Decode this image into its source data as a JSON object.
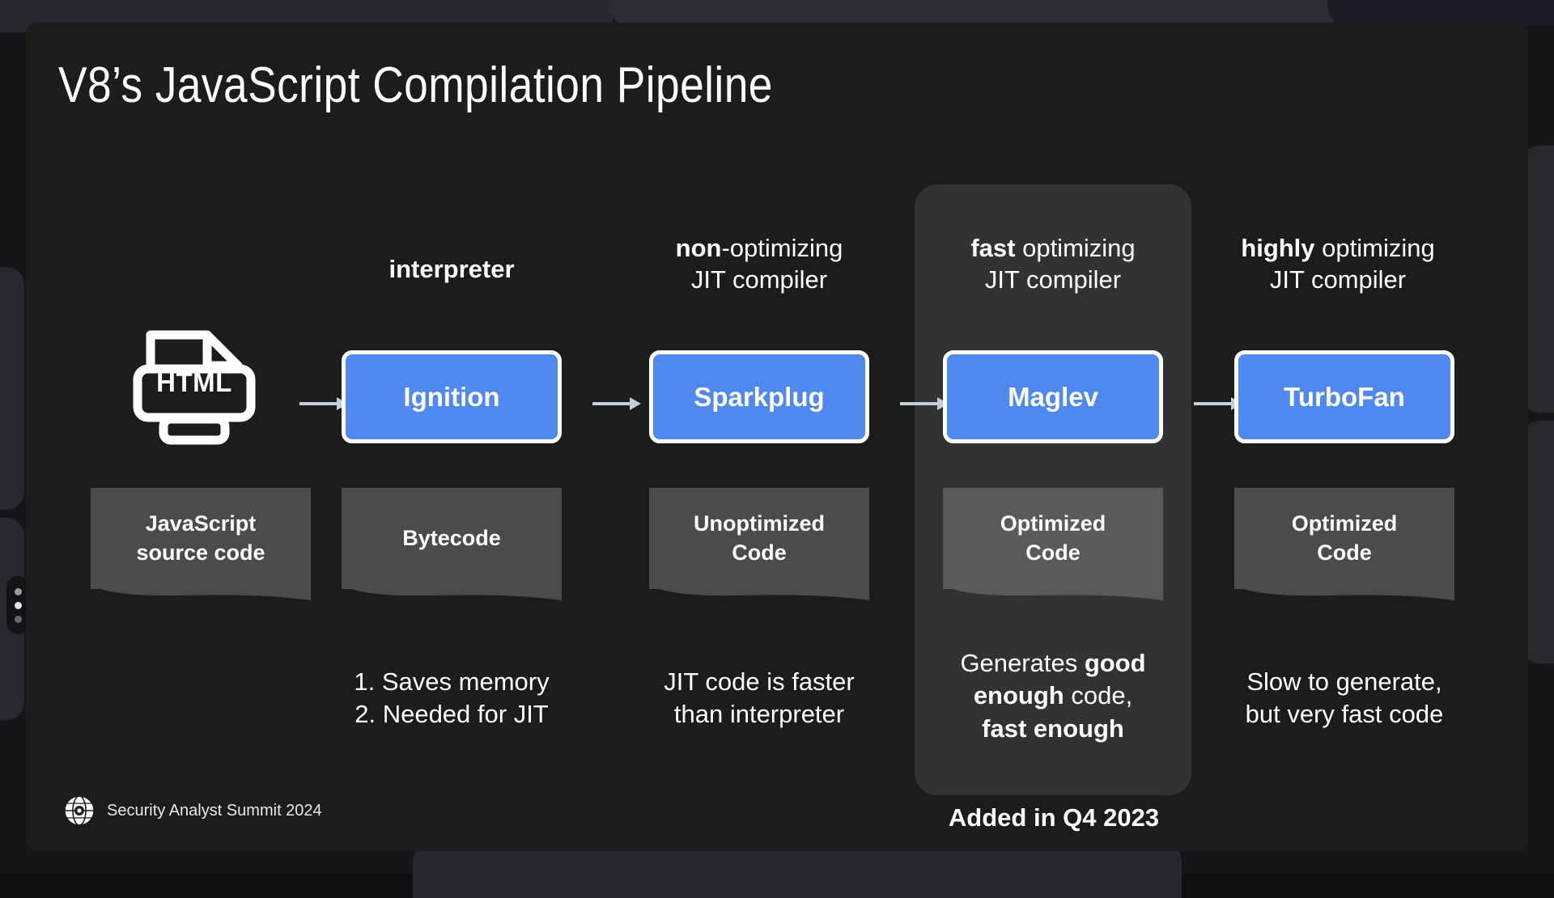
{
  "slide": {
    "title": "V8’s JavaScript Compilation Pipeline",
    "source_icon_label": "HTML",
    "added_note": "Added in Q4 2023",
    "footer": {
      "logo_icon": "globe-radar-icon",
      "text": "Security Analyst Summit 2024"
    },
    "highlighted_column_index": 3
  },
  "pipeline": {
    "source": {
      "icon": "html-document-icon",
      "icon_label": "HTML",
      "output_label": "JavaScript\nsource code",
      "output_line1": "JavaScript",
      "output_line2": "source code"
    },
    "arrow_icon": "arrow-right-icon",
    "stages": [
      {
        "heading_bold": "interpreter",
        "heading_rest": "",
        "heading_line2": "",
        "name": "Ignition",
        "output_line1": "Bytecode",
        "output_line2": "",
        "note_line1": "1. Saves memory",
        "note_line2": "2. Needed for JIT",
        "note_bold_parts": []
      },
      {
        "heading_bold": "non",
        "heading_rest": "-optimizing",
        "heading_line2": "JIT compiler",
        "name": "Sparkplug",
        "output_line1": "Unoptimized",
        "output_line2": "Code",
        "note_line1": "JIT code is faster",
        "note_line2": "than interpreter",
        "note_bold_parts": []
      },
      {
        "heading_bold": "fast",
        "heading_rest": " optimizing",
        "heading_line2": "JIT compiler",
        "name": "Maglev",
        "output_line1": "Optimized",
        "output_line2": "Code",
        "note_line1": "Generates good",
        "note_line2": "enough code,",
        "note_line3": "fast enough",
        "note_bold_parts": [
          "good",
          "enough",
          "fast enough"
        ]
      },
      {
        "heading_bold": "highly",
        "heading_rest": " optimizing",
        "heading_line2": "JIT compiler",
        "name": "TurboFan",
        "output_line1": "Optimized",
        "output_line2": "Code",
        "note_line1": "Slow to generate,",
        "note_line2": "but very fast code",
        "note_bold_parts": []
      }
    ]
  },
  "colors": {
    "slide_background": "#1b1c1b",
    "chip_blue": "#4f88ef",
    "chip_border": "#ffffff",
    "output_box_gray": "#4b4b4b",
    "highlight_panel_gray": "#323232",
    "text_white": "#ffffff",
    "arrow_gray": "#c3cedd"
  }
}
